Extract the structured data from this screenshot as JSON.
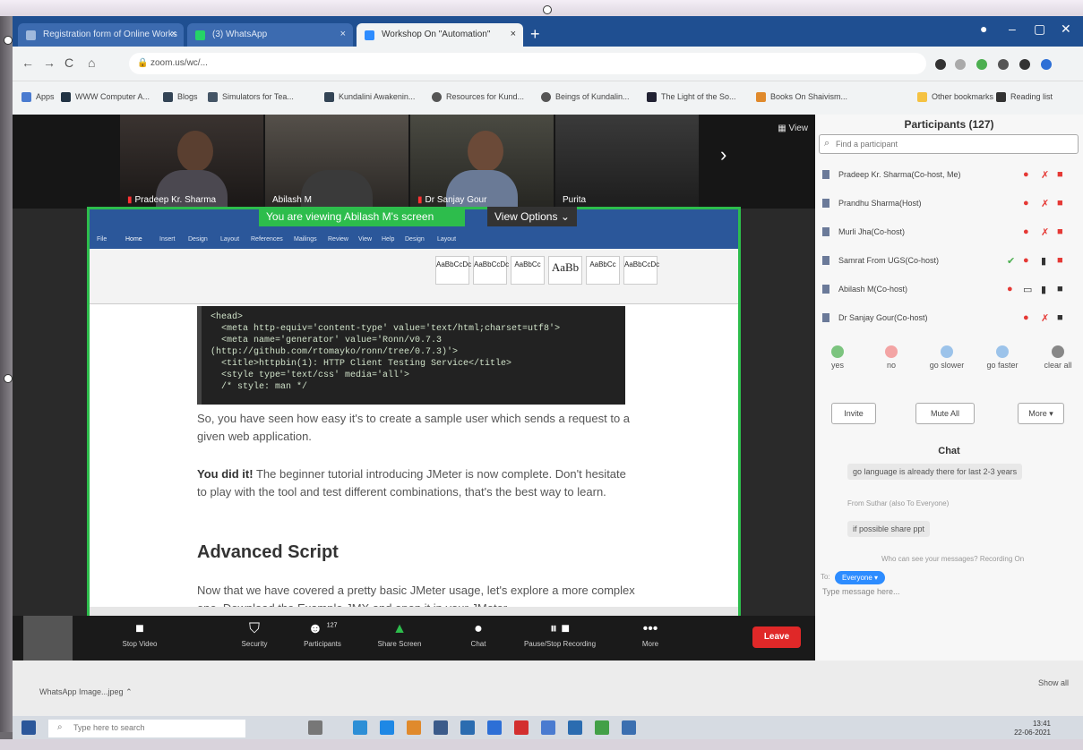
{
  "browser": {
    "tabs": [
      {
        "title": "Registration form of Online Works",
        "active": false
      },
      {
        "title": "(3) WhatsApp",
        "active": false
      },
      {
        "title": "Workshop On \"Automation\"",
        "active": true
      }
    ],
    "url": "zoom.us/wc/...",
    "bookmarks": [
      "Apps",
      "WWW Computer A...",
      "Blogs",
      "Simulators for Tea...",
      "Kundalini Awakenin...",
      "Resources for Kund...",
      "Beings of Kundalin...",
      "The Light of the So...",
      "Books On Shaivism...",
      "Other bookmarks",
      "Reading list"
    ]
  },
  "zoom": {
    "view_label": "View",
    "videos": [
      {
        "name": "Pradeep Kr. Sharma",
        "muted": true
      },
      {
        "name": "Abilash M",
        "muted": false
      },
      {
        "name": "Dr Sanjay Gour",
        "muted": true
      },
      {
        "name": "Purita",
        "muted": false
      }
    ],
    "banner": "You are viewing Abilash M's screen",
    "view_options": "View Options",
    "shared_doc": {
      "code_lines": [
        "<head>",
        "  <meta http-equiv='content-type' value='text/html;charset=utf8'>",
        "  <meta name='generator' value='Ronn/v0.7.3",
        "(http://github.com/rtomayko/ronn/tree/0.7.3)'>",
        "  <title>httpbin(1): HTTP Client Testing Service</title>",
        "  <style type='text/css' media='all'>",
        "  /* style: man */"
      ],
      "para1": "So, you have seen how easy it's to create a sample user which sends a request to a given web application.",
      "para2_bold": "You did it!",
      "para2": " The beginner tutorial introducing JMeter is now complete. Don't hesitate to play with the tool and test different combinations, that's the best way to learn.",
      "heading": "Advanced Script",
      "para3": "Now that we have covered a pretty basic JMeter usage, let's explore a more complex one. Download the Example JMX and open it in your JMeter"
    },
    "toolbar": {
      "stop_video": "Stop Video",
      "security": "Security",
      "participants": "Participants",
      "participants_count": "127",
      "share_screen": "Share Screen",
      "chat": "Chat",
      "recording": "Pause/Stop Recording",
      "more": "More",
      "leave": "Leave"
    }
  },
  "participants_panel": {
    "title": "Participants (127)",
    "search_placeholder": "Find a participant",
    "rows": [
      {
        "name": "Pradeep Kr. Sharma(Co-host, Me)"
      },
      {
        "name": "Prandhu Sharma(Host)"
      },
      {
        "name": "Murli Jha(Co-host)"
      },
      {
        "name": "Samrat From UGS(Co-host)"
      },
      {
        "name": "Abilash M(Co-host)"
      },
      {
        "name": "Dr Sanjay Gour(Co-host)"
      }
    ],
    "reactions": [
      "yes",
      "no",
      "go slower",
      "go faster",
      "clear all"
    ],
    "invite": "Invite",
    "mute_all": "Mute All",
    "more": "More",
    "chat_title": "Chat",
    "messages": [
      {
        "text": "go language is already there for last 2-3 years"
      },
      {
        "meta": "From Suthar (also To Everyone)"
      },
      {
        "text": "if possible share ppt"
      }
    ],
    "recording_note": "Who can see your messages? Recording On",
    "to_label": "To:",
    "everyone": "Everyone",
    "type_placeholder": "Type message here..."
  },
  "downloads": {
    "file": "WhatsApp Image...jpeg",
    "show_all": "Show all"
  },
  "taskbar": {
    "search_placeholder": "Type here to search",
    "time": "13:41",
    "date": "22-06-2021"
  }
}
